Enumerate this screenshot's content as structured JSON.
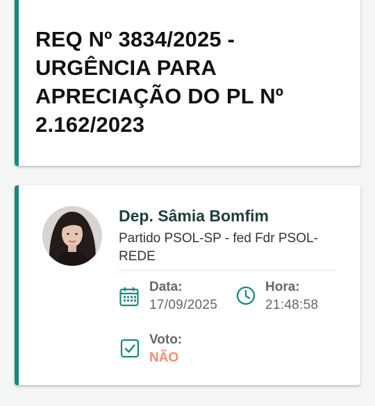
{
  "request": {
    "title": "REQ Nº 3834/2025 - URGÊNCIA PARA APRECIAÇÃO DO PL Nº 2.162/2023"
  },
  "vote_card": {
    "deputy_name": "Dep. Sâmia Bomfim",
    "party": "Partido PSOL-SP - fed Fdr PSOL-REDE",
    "date_label": "Data:",
    "date_value": "17/09/2025",
    "time_label": "Hora:",
    "time_value": "21:48:58",
    "vote_label": "Voto:",
    "vote_value": "NÃO",
    "icons": {
      "date": "calendar-icon",
      "time": "clock-icon",
      "vote": "checkbox-icon"
    },
    "colors": {
      "accent": "#16897c",
      "vote_no": "#f08d72",
      "name": "#1d3f3a"
    }
  }
}
